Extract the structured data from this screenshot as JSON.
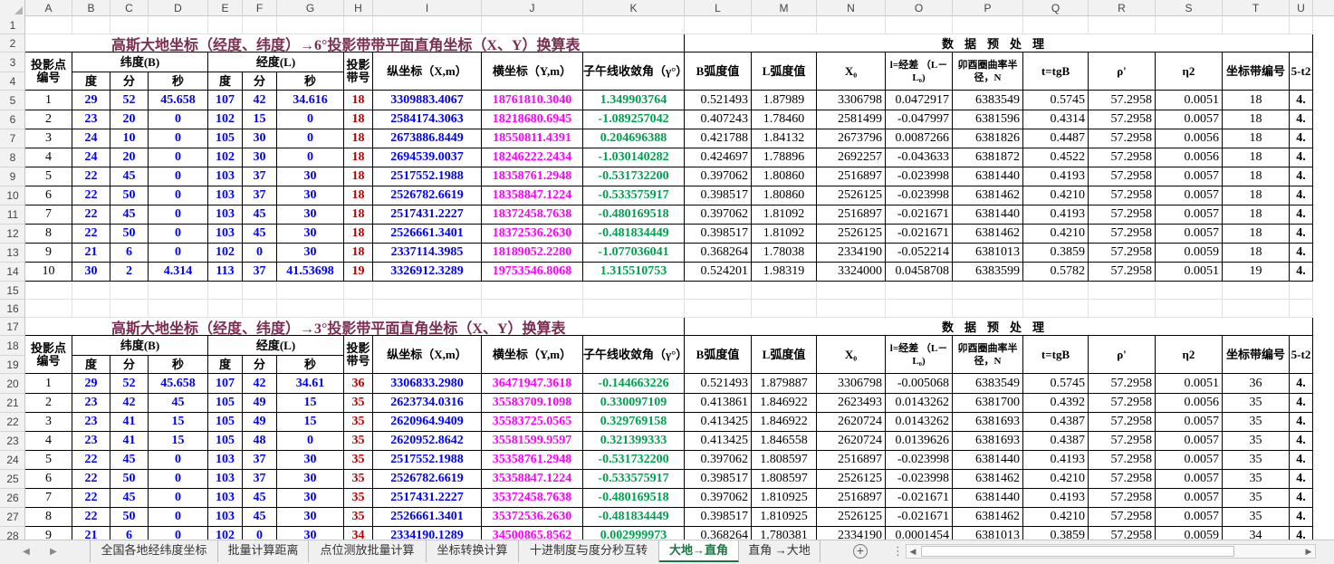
{
  "columns": [
    "A",
    "B",
    "C",
    "D",
    "E",
    "F",
    "G",
    "H",
    "I",
    "J",
    "K",
    "L",
    "M",
    "N",
    "O",
    "P",
    "Q",
    "R",
    "S",
    "T",
    "U"
  ],
  "rows": [
    "1",
    "2",
    "3",
    "4",
    "5",
    "6",
    "7",
    "8",
    "9",
    "10",
    "11",
    "12",
    "13",
    "14",
    "15",
    "16",
    "17",
    "18",
    "19",
    "20",
    "21",
    "22",
    "23",
    "24",
    "25",
    "26",
    "27",
    "28"
  ],
  "title_6": "高斯大地坐标（经度、纬度）→6°投影带带平面直角坐标（X、Y）换算表",
  "title_3": "高斯大地坐标（经度、纬度）→3°投影带平面直角坐标（X、Y）换算表",
  "pre_label": "数据预处理",
  "headers": {
    "point": "投影点编号",
    "lat": "纬度(B)",
    "lon": "经度(L)",
    "deg": "度",
    "min": "分",
    "sec": "秒",
    "zone": "投影带号",
    "x": "纵坐标（X,m）",
    "y": "横坐标（Y,m）",
    "conv": "子午线收敛角（γ°）",
    "brad": "B弧度值",
    "lrad": "L弧度值",
    "x0": "X₀",
    "l": "l=经差 （L－L₀)",
    "n": "卯酉圈曲率半径，N",
    "t": "t=tgB",
    "rho": "ρ'",
    "eta": "η2",
    "zoneno": "坐标带编号",
    "u": "5-t2"
  },
  "table6": [
    [
      "1",
      "29",
      "52",
      "45.658",
      "107",
      "42",
      "34.616",
      "18",
      "3309883.4067",
      "18761810.3040",
      "1.349903764",
      "0.521493",
      "1.87989",
      "3306798",
      "0.0472917",
      "6383549",
      "0.5745",
      "57.2958",
      "0.0051",
      "18",
      "4."
    ],
    [
      "2",
      "23",
      "20",
      "0",
      "102",
      "15",
      "0",
      "18",
      "2584174.3063",
      "18218680.6945",
      "-1.089257042",
      "0.407243",
      "1.78460",
      "2581499",
      "-0.047997",
      "6381596",
      "0.4314",
      "57.2958",
      "0.0057",
      "18",
      "4."
    ],
    [
      "3",
      "24",
      "10",
      "0",
      "105",
      "30",
      "0",
      "18",
      "2673886.8449",
      "18550811.4391",
      "0.204696388",
      "0.421788",
      "1.84132",
      "2673796",
      "0.0087266",
      "6381826",
      "0.4487",
      "57.2958",
      "0.0056",
      "18",
      "4."
    ],
    [
      "4",
      "24",
      "20",
      "0",
      "102",
      "30",
      "0",
      "18",
      "2694539.0037",
      "18246222.2434",
      "-1.030140282",
      "0.424697",
      "1.78896",
      "2692257",
      "-0.043633",
      "6381872",
      "0.4522",
      "57.2958",
      "0.0056",
      "18",
      "4."
    ],
    [
      "5",
      "22",
      "45",
      "0",
      "103",
      "37",
      "30",
      "18",
      "2517552.1988",
      "18358761.2948",
      "-0.531732200",
      "0.397062",
      "1.80860",
      "2516897",
      "-0.023998",
      "6381440",
      "0.4193",
      "57.2958",
      "0.0057",
      "18",
      "4."
    ],
    [
      "6",
      "22",
      "50",
      "0",
      "103",
      "37",
      "30",
      "18",
      "2526782.6619",
      "18358847.1224",
      "-0.533575917",
      "0.398517",
      "1.80860",
      "2526125",
      "-0.023998",
      "6381462",
      "0.4210",
      "57.2958",
      "0.0057",
      "18",
      "4."
    ],
    [
      "7",
      "22",
      "45",
      "0",
      "103",
      "45",
      "30",
      "18",
      "2517431.2227",
      "18372458.7638",
      "-0.480169518",
      "0.397062",
      "1.81092",
      "2516897",
      "-0.021671",
      "6381440",
      "0.4193",
      "57.2958",
      "0.0057",
      "18",
      "4."
    ],
    [
      "8",
      "22",
      "50",
      "0",
      "103",
      "45",
      "30",
      "18",
      "2526661.3401",
      "18372536.2630",
      "-0.481834449",
      "0.398517",
      "1.81092",
      "2526125",
      "-0.021671",
      "6381462",
      "0.4210",
      "57.2958",
      "0.0057",
      "18",
      "4."
    ],
    [
      "9",
      "21",
      "6",
      "0",
      "102",
      "0",
      "30",
      "18",
      "2337114.3985",
      "18189052.2280",
      "-1.077036041",
      "0.368264",
      "1.78038",
      "2334190",
      "-0.052214",
      "6381013",
      "0.3859",
      "57.2958",
      "0.0059",
      "18",
      "4."
    ],
    [
      "10",
      "30",
      "2",
      "4.314",
      "113",
      "37",
      "41.53698",
      "19",
      "3326912.3289",
      "19753546.8068",
      "1.315510753",
      "0.524201",
      "1.98319",
      "3324000",
      "0.0458708",
      "6383599",
      "0.5782",
      "57.2958",
      "0.0051",
      "19",
      "4."
    ]
  ],
  "table3": [
    [
      "1",
      "29",
      "52",
      "45.658",
      "107",
      "42",
      "34.61",
      "36",
      "3306833.2980",
      "36471947.3618",
      "-0.144663226",
      "0.521493",
      "1.879887",
      "3306798",
      "-0.005068",
      "6383549",
      "0.5745",
      "57.2958",
      "0.0051",
      "36",
      "4."
    ],
    [
      "2",
      "23",
      "42",
      "45",
      "105",
      "49",
      "15",
      "35",
      "2623734.0316",
      "35583709.1098",
      "0.330097109",
      "0.413861",
      "1.846922",
      "2623493",
      "0.0143262",
      "6381700",
      "0.4392",
      "57.2958",
      "0.0056",
      "35",
      "4."
    ],
    [
      "3",
      "23",
      "41",
      "15",
      "105",
      "49",
      "15",
      "35",
      "2620964.9409",
      "35583725.0565",
      "0.329769158",
      "0.413425",
      "1.846922",
      "2620724",
      "0.0143262",
      "6381693",
      "0.4387",
      "57.2958",
      "0.0057",
      "35",
      "4."
    ],
    [
      "4",
      "23",
      "41",
      "15",
      "105",
      "48",
      "0",
      "35",
      "2620952.8642",
      "35581599.9597",
      "0.321399333",
      "0.413425",
      "1.846558",
      "2620724",
      "0.0139626",
      "6381693",
      "0.4387",
      "57.2958",
      "0.0057",
      "35",
      "4."
    ],
    [
      "5",
      "22",
      "45",
      "0",
      "103",
      "37",
      "30",
      "35",
      "2517552.1988",
      "35358761.2948",
      "-0.531732200",
      "0.397062",
      "1.808597",
      "2516897",
      "-0.023998",
      "6381440",
      "0.4193",
      "57.2958",
      "0.0057",
      "35",
      "4."
    ],
    [
      "6",
      "22",
      "50",
      "0",
      "103",
      "37",
      "30",
      "35",
      "2526782.6619",
      "35358847.1224",
      "-0.533575917",
      "0.398517",
      "1.808597",
      "2526125",
      "-0.023998",
      "6381462",
      "0.4210",
      "57.2958",
      "0.0057",
      "35",
      "4."
    ],
    [
      "7",
      "22",
      "45",
      "0",
      "103",
      "45",
      "30",
      "35",
      "2517431.2227",
      "35372458.7638",
      "-0.480169518",
      "0.397062",
      "1.810925",
      "2516897",
      "-0.021671",
      "6381440",
      "0.4193",
      "57.2958",
      "0.0057",
      "35",
      "4."
    ],
    [
      "8",
      "22",
      "50",
      "0",
      "103",
      "45",
      "30",
      "35",
      "2526661.3401",
      "35372536.2630",
      "-0.481834449",
      "0.398517",
      "1.810925",
      "2526125",
      "-0.021671",
      "6381462",
      "0.4210",
      "57.2958",
      "0.0057",
      "35",
      "4."
    ],
    [
      "9",
      "21",
      "6",
      "0",
      "102",
      "0",
      "30",
      "34",
      "2334190.1289",
      "34500865.8562",
      "0.002999973",
      "0.368264",
      "1.780381",
      "2334190",
      "0.0001454",
      "6381013",
      "0.3859",
      "57.2958",
      "0.0059",
      "34",
      "4."
    ]
  ],
  "tabs": [
    "全国各地经纬度坐标",
    "批量计算距离",
    "点位测放批量计算",
    "坐标转换计算",
    "十进制度与度分秒互转",
    "大地→直角",
    "直角 →大地"
  ],
  "active_tab": "大地→直角",
  "add_sheet": "+",
  "dots": "⋮",
  "nav_prev": "◀",
  "nav_next": "▶",
  "scroll_left": "◀",
  "scroll_right": "▶"
}
